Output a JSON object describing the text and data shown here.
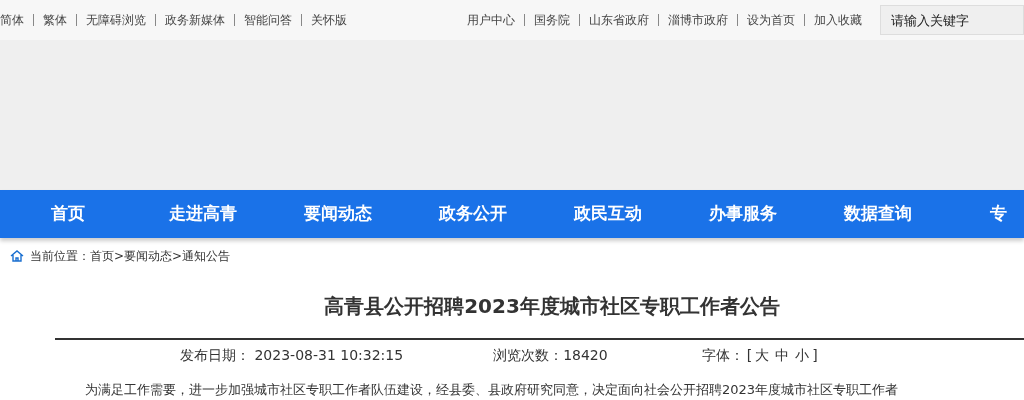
{
  "top_bar": {
    "left_links": [
      "简体",
      "繁体",
      "无障碍浏览",
      "政务新媒体",
      "智能问答",
      "关怀版"
    ],
    "right_links": [
      "用户中心",
      "国务院",
      "山东省政府",
      "淄博市政府",
      "设为首页",
      "加入收藏"
    ],
    "search": {
      "placeholder": "请输入关键字"
    }
  },
  "nav": [
    "首页",
    "走进高青",
    "要闻动态",
    "政务公开",
    "政民互动",
    "办事服务",
    "数据查询",
    "专"
  ],
  "breadcrumb": {
    "label": "当前位置：",
    "path": "首页>要闻动态>通知公告"
  },
  "article": {
    "title": "高青县公开招聘2023年度城市社区专职工作者公告",
    "date_label": "发布日期：",
    "date": "2023-08-31 10:32:15",
    "views_label": "浏览次数：",
    "views": "18420",
    "font_label": "字体：",
    "font_brackets": [
      "[",
      "]"
    ],
    "font_sizes": [
      "大",
      "中",
      "小"
    ],
    "body": "为满足工作需要，进一步加强城市社区专职工作者队伍建设，经县委、县政府研究同意，决定面向社会公开招聘2023年度城市社区专职工作者"
  }
}
